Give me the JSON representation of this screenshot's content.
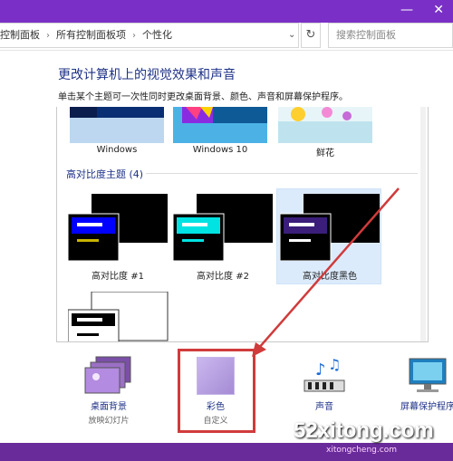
{
  "window": {
    "minimize_glyph": "—",
    "close_glyph": "✕"
  },
  "address": {
    "crumbs": [
      "控制面板",
      "所有控制面板项",
      "个性化"
    ],
    "separator": "›",
    "dropdown": "⌄",
    "refresh_glyph": "↻",
    "search_placeholder": "搜索控制面板"
  },
  "main": {
    "heading": "更改计算机上的视觉效果和声音",
    "subheading": "单击某个主题可一次性同时更改桌面背景、颜色、声音和屏幕保护程序。"
  },
  "themes_top": [
    {
      "label": "Windows"
    },
    {
      "label": "Windows 10"
    },
    {
      "label": "鲜花"
    }
  ],
  "high_contrast": {
    "title": "高对比度主题 (4)",
    "themes": [
      {
        "label": "高对比度 #1",
        "accent": "#0000ff",
        "bar": "#c8b400"
      },
      {
        "label": "高对比度 #2",
        "accent": "#00e3e3",
        "bar": "#00e3e3"
      },
      {
        "label": "高对比度黑色",
        "accent": "#3a1e7a",
        "bar": "#ffffff"
      }
    ]
  },
  "bottom": [
    {
      "label": "桌面背景",
      "sub": "放映幻灯片"
    },
    {
      "label": "彩色",
      "sub": "自定义"
    },
    {
      "label": "声音",
      "sub": ""
    },
    {
      "label": "屏幕保护程序",
      "sub": ""
    }
  ],
  "watermark": {
    "text": "52xitong.com",
    "sub": "xitongcheng.com"
  },
  "colors": {
    "titlebar": "#7a30c6",
    "link": "#1e3287",
    "highlight": "#d03b3b"
  }
}
